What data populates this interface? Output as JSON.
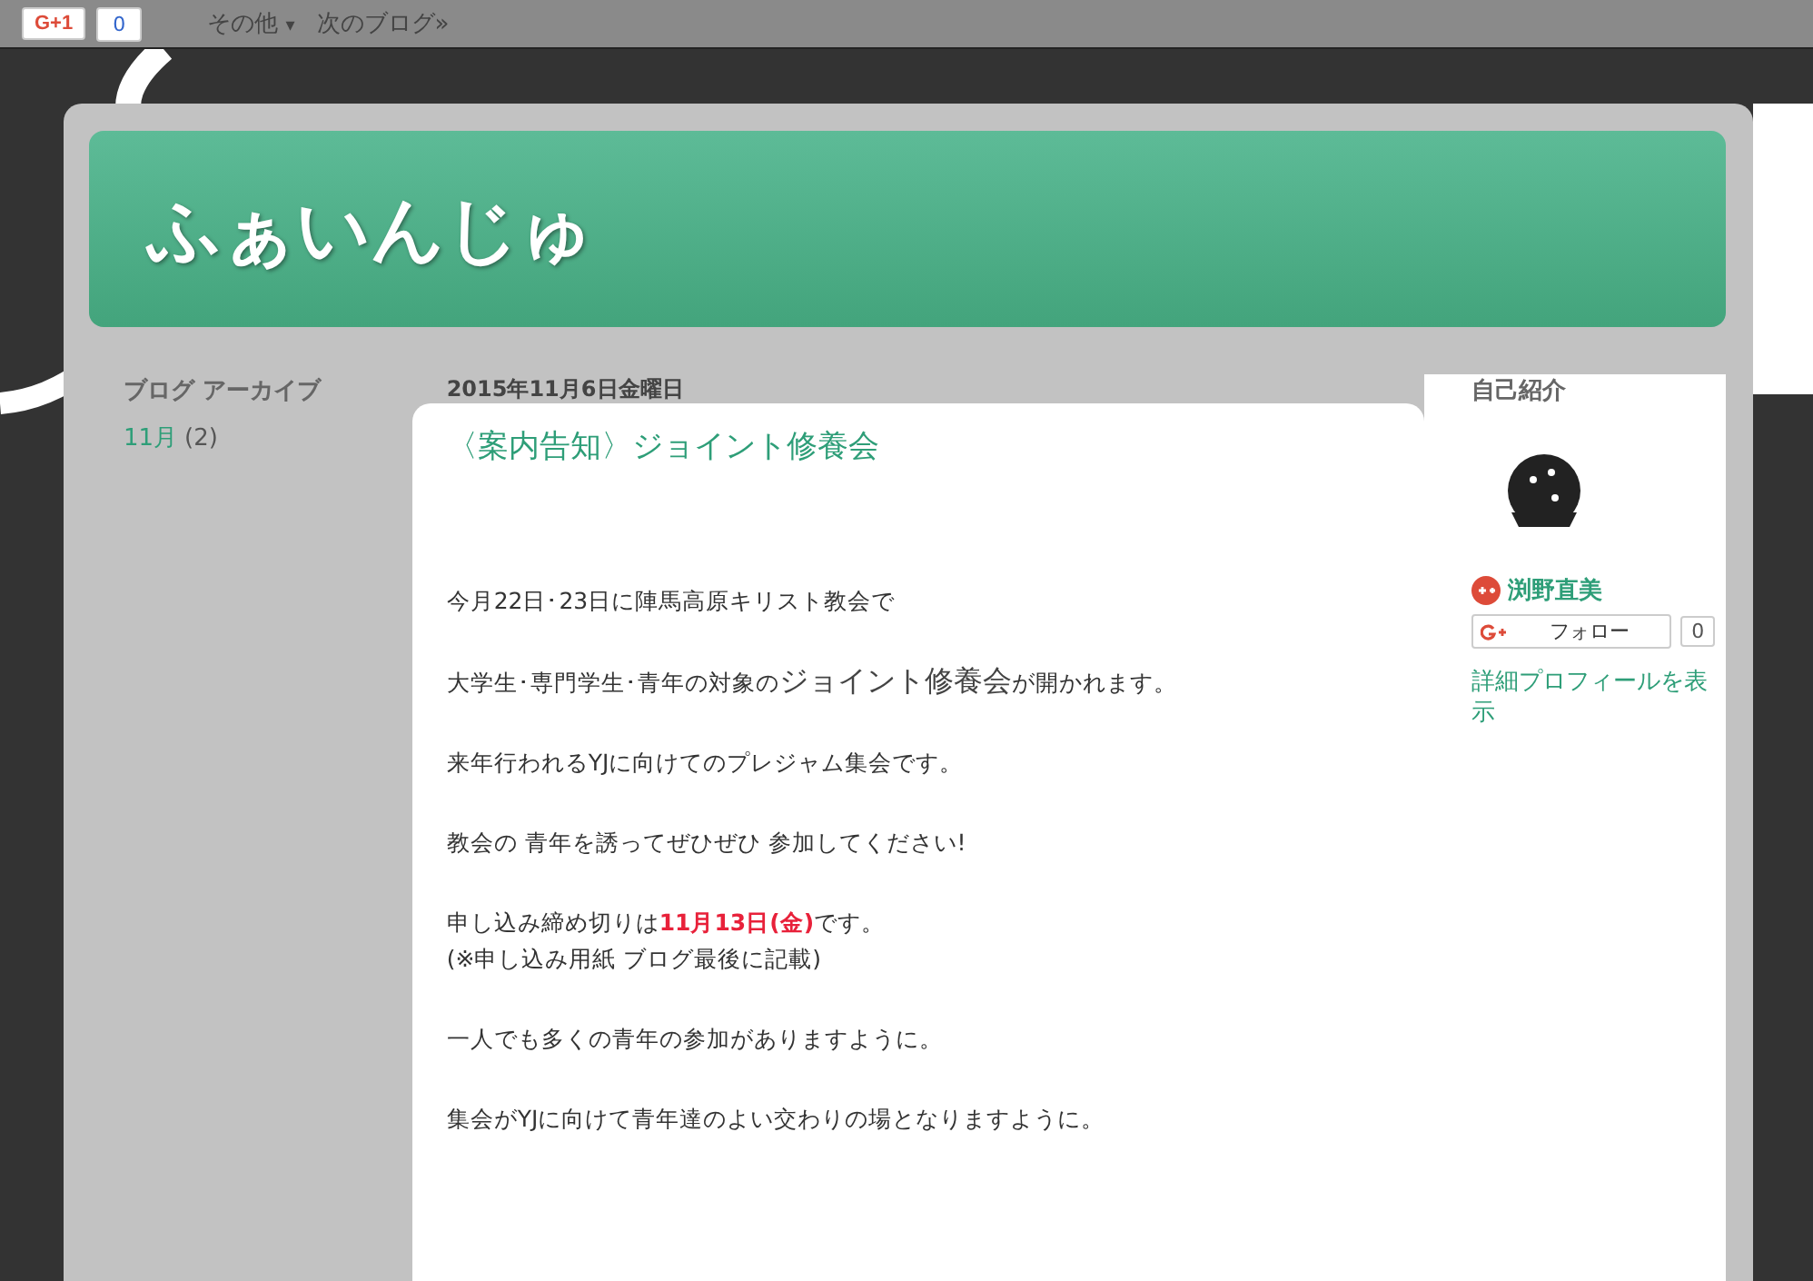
{
  "navbar": {
    "gplus_label": "G+1",
    "gplus_count": "0",
    "more": "その他",
    "more_caret": "▾",
    "next_blog": "次のブログ»"
  },
  "header": {
    "title": "ふぁいんじゅ"
  },
  "left_sidebar": {
    "heading": "ブログ アーカイブ",
    "archive": [
      {
        "month": "11月",
        "count": "(2)"
      }
    ]
  },
  "post": {
    "date": "2015年11月6日金曜日",
    "title": "〈案内告知〉ジョイント修養会",
    "paragraphs": [
      {
        "text": "今月22日･23日に陣馬高原キリスト教会で",
        "kind": "plain"
      },
      {
        "text": "大学生･専門学生･青年の対象の**ジョイント修養会**が開かれます。",
        "kind": "large"
      },
      {
        "text": "来年行われるYJに向けてのプレジャム集会です。",
        "kind": "plain"
      },
      {
        "text": "教会の 青年を誘ってぜひぜひ 参加してください!",
        "kind": "plain"
      },
      {
        "text": "申し込み締め切りは**11月13日(金)**です。\n(※申し込み用紙  ブログ最後に記載)",
        "kind": "red"
      },
      {
        "text": "一人でも多くの青年の参加がありますように。",
        "kind": "plain"
      },
      {
        "text": "集会がYJに向けて青年達のよい交わりの場となりますように。",
        "kind": "plain"
      }
    ]
  },
  "right_sidebar": {
    "heading": "自己紹介",
    "profile_name": "渕野直美",
    "follow_label": "フォロー",
    "follow_count": "0",
    "view_profile": "詳細プロフィールを表示"
  }
}
